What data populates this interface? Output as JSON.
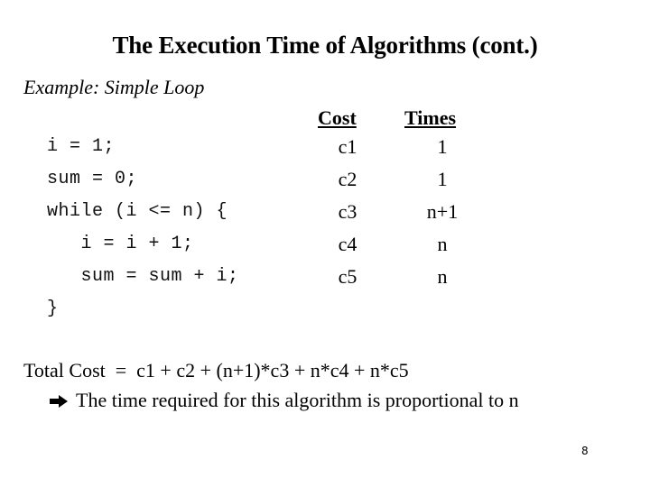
{
  "slide": {
    "title": "The Execution Time of Algorithms (cont.)",
    "subtitle": "Example: Simple Loop",
    "code_lines": [
      "i = 1;",
      "sum = 0;",
      "while (i <= n) {",
      "   i = i + 1;",
      "   sum = sum + i;",
      "}"
    ],
    "table": {
      "headers": {
        "cost": "Cost",
        "times": "Times"
      },
      "rows": [
        {
          "cost": "c1",
          "times": "1"
        },
        {
          "cost": "c2",
          "times": "1"
        },
        {
          "cost": "c3",
          "times": "n+1"
        },
        {
          "cost": "c4",
          "times": "n"
        },
        {
          "cost": "c5",
          "times": "n"
        }
      ]
    },
    "total_cost": "Total Cost  =  c1 + c2 + (n+1)*c3 + n*c4 + n*c5",
    "conclusion_icon": "right-arrow-icon",
    "conclusion": "The time required for this algorithm is proportional to n",
    "page_number": "8"
  }
}
